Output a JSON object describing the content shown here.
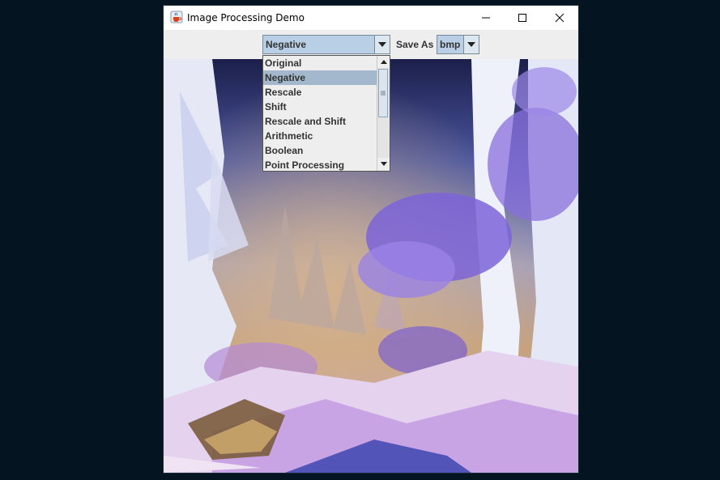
{
  "window": {
    "title": "Image Processing Demo",
    "icon": "java-cup-icon",
    "controls": [
      "minimize-icon",
      "maximize-icon",
      "close-icon"
    ]
  },
  "toolbar": {
    "operation_value": "Negative",
    "save_as_label": "Save As",
    "format_value": "bmp"
  },
  "dropdown": {
    "items": [
      {
        "label": "Original",
        "selected": false
      },
      {
        "label": "Negative",
        "selected": true
      },
      {
        "label": "Rescale",
        "selected": false
      },
      {
        "label": "Shift",
        "selected": false
      },
      {
        "label": "Rescale and Shift",
        "selected": false
      },
      {
        "label": "Arithmetic",
        "selected": false
      },
      {
        "label": "Boolean",
        "selected": false
      },
      {
        "label": "Point Processing",
        "selected": false
      }
    ]
  },
  "image": {
    "description_icon": "negative-forest-image"
  },
  "colors": {
    "desktop": "#041420",
    "selection": "#a3b8cc",
    "combo": "#b8cfe5"
  }
}
